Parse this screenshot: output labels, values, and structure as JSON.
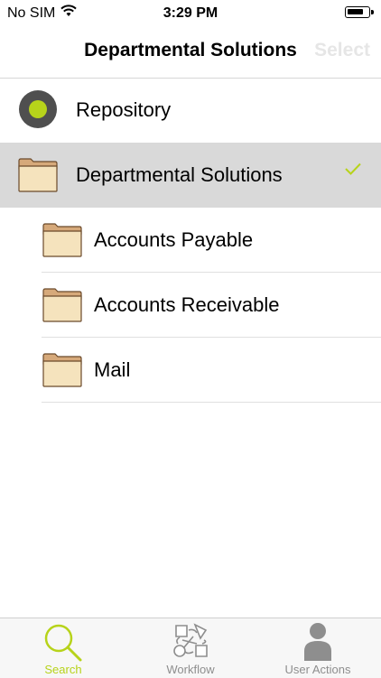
{
  "status_bar": {
    "carrier": "No SIM",
    "time": "3:29 PM"
  },
  "nav": {
    "title": "Departmental Solutions",
    "select_label": "Select"
  },
  "tree": {
    "root": {
      "label": "Repository",
      "icon": "repository-icon"
    },
    "selected": {
      "label": "Departmental Solutions",
      "icon": "folder-icon",
      "checked": true
    },
    "children": [
      {
        "label": "Accounts Payable",
        "icon": "folder-icon"
      },
      {
        "label": "Accounts Receivable",
        "icon": "folder-icon"
      },
      {
        "label": "Mail",
        "icon": "folder-icon"
      }
    ]
  },
  "tabbar": {
    "tabs": [
      {
        "label": "Search",
        "icon": "search-icon",
        "active": true
      },
      {
        "label": "Workflow",
        "icon": "workflow-icon",
        "active": false
      },
      {
        "label": "User Actions",
        "icon": "user-icon",
        "active": false
      }
    ]
  },
  "colors": {
    "accent": "#b7d31a",
    "selected_row": "#d9d9d9",
    "inactive_tab": "#8e8e8e",
    "folder_fill": "#f5e3bd",
    "folder_tab": "#d6a97a"
  }
}
